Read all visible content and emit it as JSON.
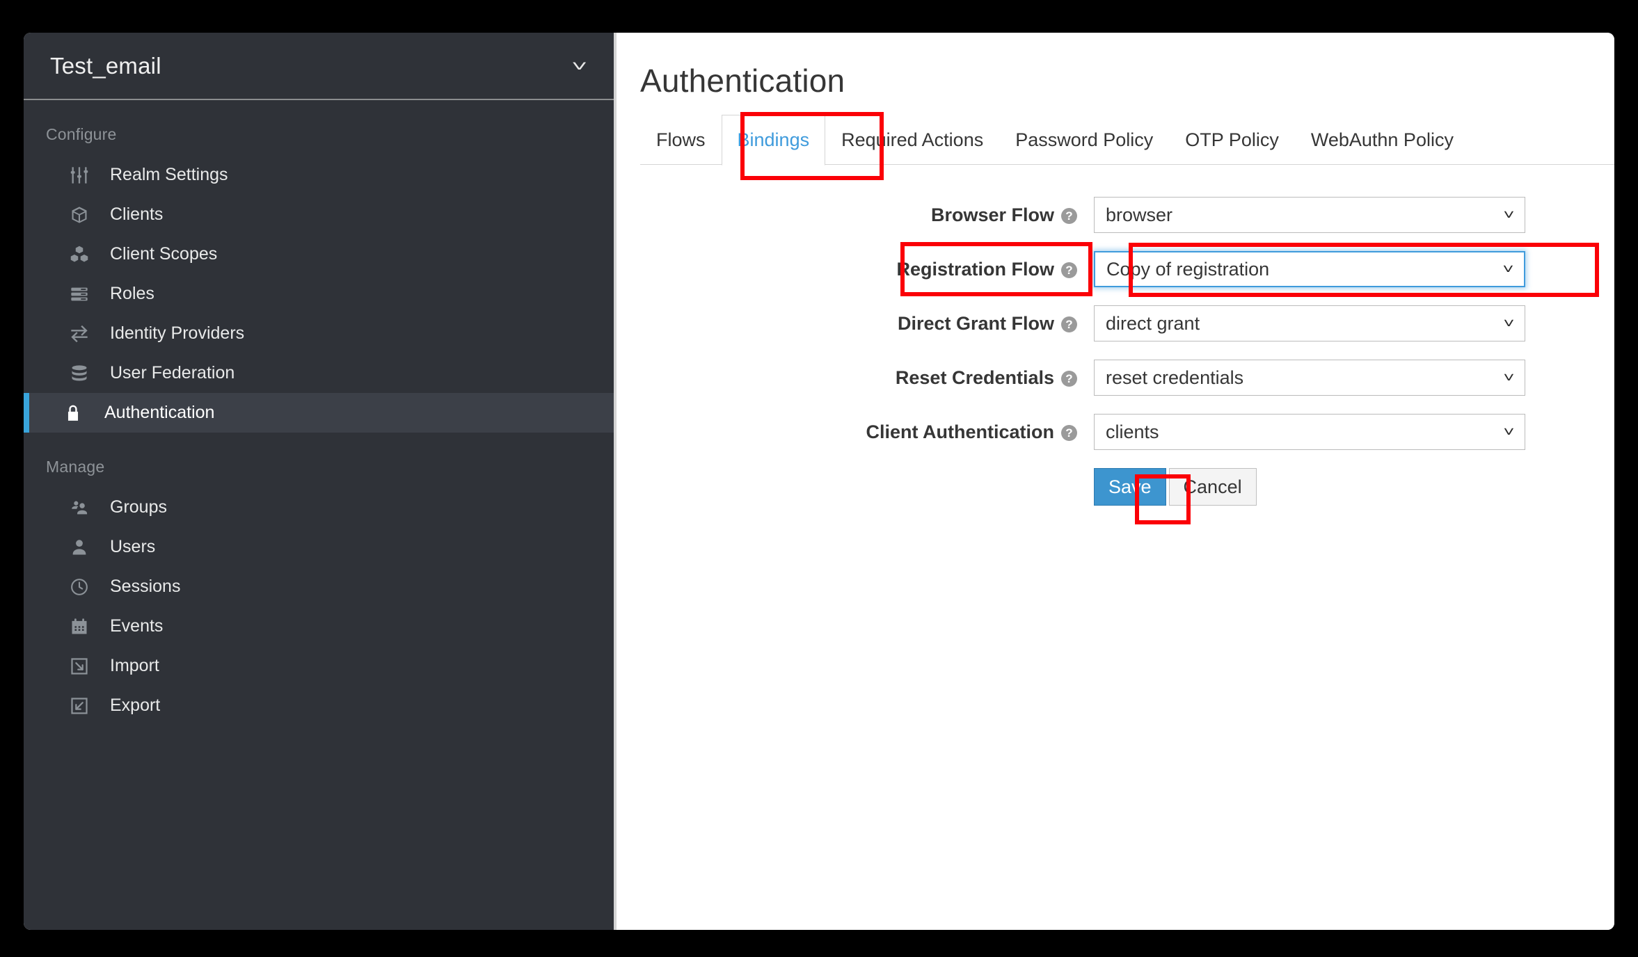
{
  "sidebar": {
    "realm": {
      "name": "Test_email",
      "caret_icon": "chevron-down-icon"
    },
    "sections": [
      {
        "heading": "Configure",
        "items": [
          {
            "label": "Realm Settings",
            "icon": "sliders-icon",
            "active": false
          },
          {
            "label": "Clients",
            "icon": "cube-icon",
            "active": false
          },
          {
            "label": "Client Scopes",
            "icon": "cubes-icon",
            "active": false
          },
          {
            "label": "Roles",
            "icon": "list-rows-icon",
            "active": false
          },
          {
            "label": "Identity Providers",
            "icon": "exchange-arrows-icon",
            "active": false
          },
          {
            "label": "User Federation",
            "icon": "database-icon",
            "active": false
          },
          {
            "label": "Authentication",
            "icon": "lock-icon",
            "active": true
          }
        ]
      },
      {
        "heading": "Manage",
        "items": [
          {
            "label": "Groups",
            "icon": "users-group-icon",
            "active": false
          },
          {
            "label": "Users",
            "icon": "user-icon",
            "active": false
          },
          {
            "label": "Sessions",
            "icon": "clock-icon",
            "active": false
          },
          {
            "label": "Events",
            "icon": "calendar-icon",
            "active": false
          },
          {
            "label": "Import",
            "icon": "import-arrow-icon",
            "active": false
          },
          {
            "label": "Export",
            "icon": "export-arrow-icon",
            "active": false
          }
        ]
      }
    ]
  },
  "main": {
    "page_title": "Authentication",
    "tabs": [
      {
        "label": "Flows",
        "active": false
      },
      {
        "label": "Bindings",
        "active": true
      },
      {
        "label": "Required Actions",
        "active": false
      },
      {
        "label": "Password Policy",
        "active": false
      },
      {
        "label": "OTP Policy",
        "active": false
      },
      {
        "label": "WebAuthn Policy",
        "active": false
      }
    ],
    "form": {
      "rows": [
        {
          "label": "Browser Flow",
          "help_icon": "help-circle-icon",
          "value": "browser",
          "focused": false
        },
        {
          "label": "Registration Flow",
          "help_icon": "help-circle-icon",
          "value": "Copy of registration",
          "focused": true
        },
        {
          "label": "Direct Grant Flow",
          "help_icon": "help-circle-icon",
          "value": "direct grant",
          "focused": false
        },
        {
          "label": "Reset Credentials",
          "help_icon": "help-circle-icon",
          "value": "reset credentials",
          "focused": false
        },
        {
          "label": "Client Authentication",
          "help_icon": "help-circle-icon",
          "value": "clients",
          "focused": false
        }
      ],
      "save_label": "Save",
      "cancel_label": "Cancel"
    }
  },
  "colors": {
    "sidebar_bg": "#2f3238",
    "sidebar_active_bg": "#3c4048",
    "accent_blue": "#39a5dc",
    "tab_active_text": "#3f9bdc",
    "primary_button": "#3d95cf",
    "annotation_red": "#fb0007",
    "page_bg": "#ffffff",
    "frame_black": "#000000"
  }
}
